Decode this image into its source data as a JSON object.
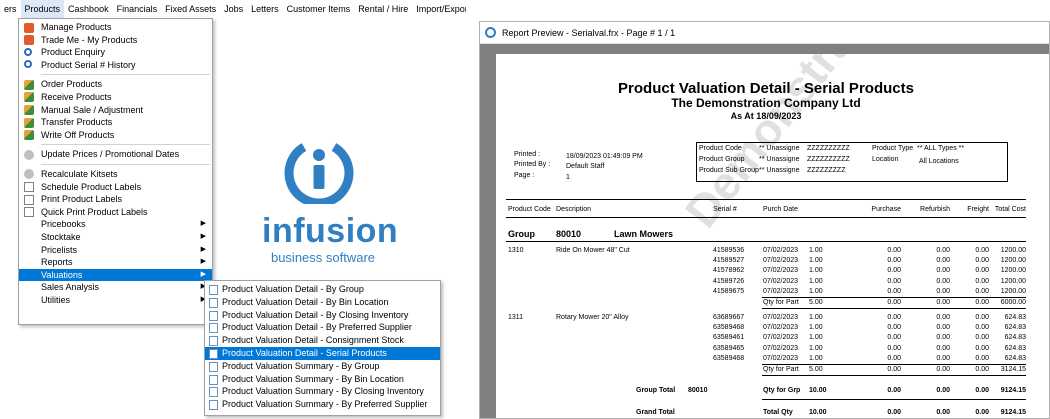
{
  "menubar": {
    "items": [
      "ers",
      "Products",
      "Cashbook",
      "Financials",
      "Fixed Assets",
      "Jobs",
      "Letters",
      "Customer Items",
      "Rental / Hire",
      "Import/Expor"
    ]
  },
  "products_menu": {
    "items": [
      {
        "label": "Manage Products",
        "icon": "box-icon"
      },
      {
        "label": "Trade Me - My Products",
        "icon": "box-icon"
      },
      {
        "label": "Product Enquiry",
        "icon": "magnifier-icon"
      },
      {
        "label": "Product Serial # History",
        "icon": "magnifier-icon"
      },
      {
        "label": "Order Products",
        "icon": "truck-icon"
      },
      {
        "label": "Receive Products",
        "icon": "truck-icon"
      },
      {
        "label": "Manual Sale / Adjustment",
        "icon": "truck-icon"
      },
      {
        "label": "Transfer Products",
        "icon": "truck-icon"
      },
      {
        "label": "Write Off Products",
        "icon": "truck-icon"
      },
      {
        "label": "Update Prices / Promotional Dates",
        "icon": "gear-icon"
      },
      {
        "label": "Recalculate Kitsets",
        "icon": "gear-icon"
      },
      {
        "label": "Schedule Product Labels",
        "icon": "label-icon"
      },
      {
        "label": "Print Product Labels",
        "icon": "label-icon"
      },
      {
        "label": "Quick Print Product Labels",
        "icon": "label-icon"
      },
      {
        "label": "Pricebooks"
      },
      {
        "label": "Stocktake"
      },
      {
        "label": "Pricelists"
      },
      {
        "label": "Reports"
      },
      {
        "label": "Valuations"
      },
      {
        "label": "Sales Analysis"
      },
      {
        "label": "Utilities"
      }
    ]
  },
  "valuations_submenu": {
    "items": [
      "Product Valuation Detail - By Group",
      "Product Valuation Detail - By Bin Location",
      "Product Valuation Detail - By Closing Inventory",
      "Product Valuation Detail - By Preferred Supplier",
      "Product Valuation Detail - Consignment Stock",
      "Product Valuation Detail - Serial Products",
      "Product Valuation Summary - By Group",
      "Product Valuation Summary - By Bin Location",
      "Product Valuation Summary - By Closing Inventory",
      "Product Valuation Summary - By Preferred Supplier"
    ]
  },
  "logo": {
    "word": "infusion",
    "tagline": "business software",
    "color": "#2f7fc2"
  },
  "report_window": {
    "title": "Report Preview - Serialval.frx - Page # 1 / 1"
  },
  "report": {
    "title": "Product Valuation Detail - Serial Products",
    "company": "The Demonstration Company Ltd",
    "as_at": "As At 18/09/2023",
    "printed_label": "Printed :",
    "printed_value": "18/09/2023 01:49:09 PM",
    "printed_by_label": "Printed By :",
    "printed_by_value": "Default Staff",
    "page_label": "Page :",
    "page_value": "1",
    "params": {
      "product_code_label": "Product Code",
      "product_code_from": "** Unassigne",
      "product_code_to": "ZZZZZZZZZZ",
      "product_group_label": "Product Group",
      "product_group_from": "** Unassigne",
      "product_group_to": "ZZZZZZZZZZ",
      "product_sub_group_label": "Product Sub Group",
      "product_sub_group_from": "** Unassigne",
      "product_sub_group_to": "ZZZZZZZZZ",
      "product_type_label": "Product Type",
      "product_type_value": "** ALL Types **",
      "location_label": "Location",
      "location_value": "All Locations"
    },
    "columns": [
      "Product Code",
      "Description",
      "Serial #",
      "Purch Date",
      "Purchase",
      "Refurbish",
      "Freight",
      "Total Cost"
    ],
    "group_label": "Group",
    "group_code": "80010",
    "group_name": "Lawn Mowers",
    "products": [
      {
        "code": "1310",
        "description": "Ride On Mower 48\" Cut",
        "rows": [
          {
            "serial": "41589536",
            "date": "07/02/2023",
            "qty": "1.00",
            "purchase": "0.00",
            "refurbish": "0.00",
            "freight": "0.00",
            "total": "1200.00"
          },
          {
            "serial": "41589527",
            "date": "07/02/2023",
            "qty": "1.00",
            "purchase": "0.00",
            "refurbish": "0.00",
            "freight": "0.00",
            "total": "1200.00"
          },
          {
            "serial": "41578962",
            "date": "07/02/2023",
            "qty": "1.00",
            "purchase": "0.00",
            "refurbish": "0.00",
            "freight": "0.00",
            "total": "1200.00"
          },
          {
            "serial": "41589726",
            "date": "07/02/2023",
            "qty": "1.00",
            "purchase": "0.00",
            "refurbish": "0.00",
            "freight": "0.00",
            "total": "1200.00"
          },
          {
            "serial": "41589675",
            "date": "07/02/2023",
            "qty": "1.00",
            "purchase": "0.00",
            "refurbish": "0.00",
            "freight": "0.00",
            "total": "1200.00"
          }
        ],
        "subtotal": {
          "label": "Qty for Part",
          "qty": "5.00",
          "purchase": "0.00",
          "refurbish": "0.00",
          "freight": "0.00",
          "total": "6000.00"
        }
      },
      {
        "code": "1311",
        "description": "Rotary Mower 20\" Alloy",
        "rows": [
          {
            "serial": "63689667",
            "date": "07/02/2023",
            "qty": "1.00",
            "purchase": "0.00",
            "refurbish": "0.00",
            "freight": "0.00",
            "total": "624.83"
          },
          {
            "serial": "63589468",
            "date": "07/02/2023",
            "qty": "1.00",
            "purchase": "0.00",
            "refurbish": "0.00",
            "freight": "0.00",
            "total": "624.83"
          },
          {
            "serial": "63589461",
            "date": "07/02/2023",
            "qty": "1.00",
            "purchase": "0.00",
            "refurbish": "0.00",
            "freight": "0.00",
            "total": "624.83"
          },
          {
            "serial": "63589465",
            "date": "07/02/2023",
            "qty": "1.00",
            "purchase": "0.00",
            "refurbish": "0.00",
            "freight": "0.00",
            "total": "624.83"
          },
          {
            "serial": "63589468",
            "date": "07/02/2023",
            "qty": "1.00",
            "purchase": "0.00",
            "refurbish": "0.00",
            "freight": "0.00",
            "total": "624.83"
          }
        ],
        "subtotal": {
          "label": "Qty for Part",
          "qty": "5.00",
          "purchase": "0.00",
          "refurbish": "0.00",
          "freight": "0.00",
          "total": "3124.15"
        }
      }
    ],
    "group_total": {
      "label": "Group Total",
      "code": "80010",
      "qty_label": "Qty for Grp",
      "qty": "10.00",
      "purchase": "0.00",
      "refurbish": "0.00",
      "freight": "0.00",
      "total": "9124.15"
    },
    "grand_total": {
      "label": "Grand Total",
      "qty_label": "Total Qty",
      "qty": "10.00",
      "purchase": "0.00",
      "refurbish": "0.00",
      "freight": "0.00",
      "total": "9124.15"
    },
    "watermark": "Demonstration Company"
  }
}
